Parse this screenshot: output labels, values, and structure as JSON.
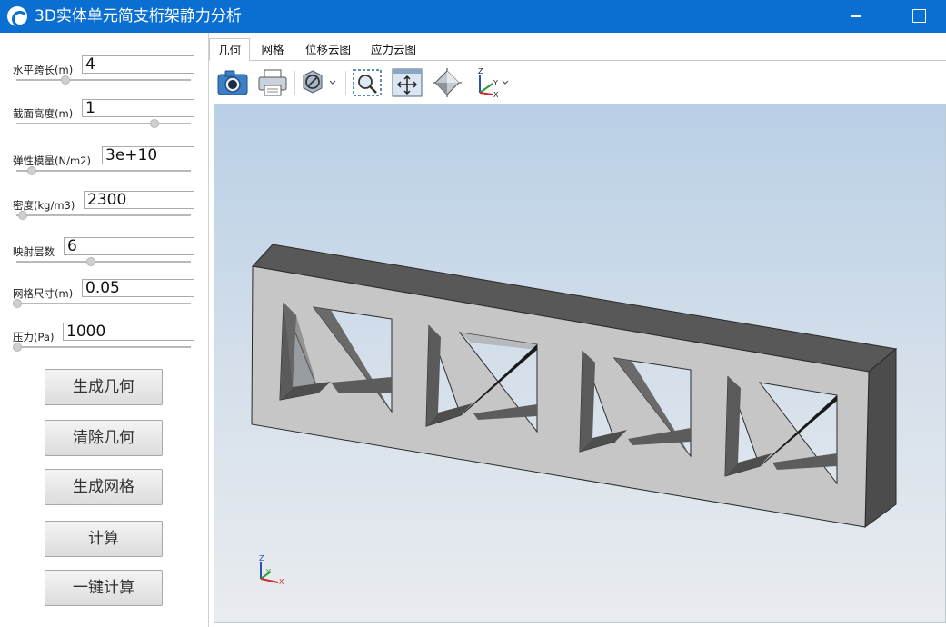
{
  "window": {
    "title": "3D实体单元简支桁架静力分析"
  },
  "params": [
    {
      "label": "水平跨长(m)",
      "value": "4",
      "slider_fraction": 0.28
    },
    {
      "label": "截面高度(m)",
      "value": "1",
      "slider_fraction": 0.8
    },
    {
      "label": "弹性模量(N/m2)",
      "value": "3e+10",
      "slider_fraction": 0.09
    },
    {
      "label": "密度(kg/m3)",
      "value": "2300",
      "slider_fraction": 0.03
    },
    {
      "label": "映射层数",
      "value": "6",
      "slider_fraction": 0.43
    },
    {
      "label": "网格尺寸(m)",
      "value": "0.05",
      "slider_fraction": 0.0
    },
    {
      "label": "压力(Pa)",
      "value": "1000",
      "slider_fraction": 0.0
    }
  ],
  "buttons": {
    "generate_geometry": "生成几何",
    "clear_geometry": "清除几何",
    "generate_mesh": "生成网格",
    "compute": "计算",
    "one_click_compute": "一键计算"
  },
  "tabs": [
    {
      "label": "几何",
      "active": true
    },
    {
      "label": "网格",
      "active": false
    },
    {
      "label": "位移云图",
      "active": false
    },
    {
      "label": "应力云图",
      "active": false
    }
  ],
  "toolbar": {
    "icons": [
      "camera-icon",
      "printer-icon",
      "section-plane-icon",
      "zoom-window-icon",
      "fit-all-icon",
      "view-cube-icon",
      "axes-view-icon"
    ]
  },
  "triad": {
    "z": "Z",
    "y": "Y",
    "x": "X"
  },
  "colors": {
    "titlebar": "#0a6fd1",
    "truss_front": "#c6c6c6",
    "truss_top": "#565656",
    "truss_inner_dark": "#5a5a5a"
  }
}
